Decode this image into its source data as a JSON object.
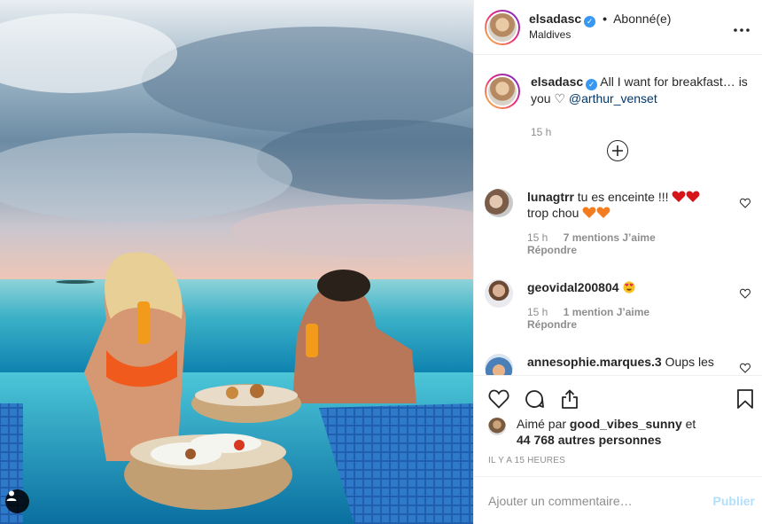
{
  "header": {
    "username": "elsadasc",
    "separator": "•",
    "follow_status": "Abonné(e)",
    "location": "Maldives",
    "more_icon": "more-horizontal-icon"
  },
  "caption": {
    "username": "elsadasc",
    "text": "All I want for breakfast… is you ♡",
    "mention": "@arthur_venset",
    "time": "15 h"
  },
  "comments": [
    {
      "username": "lunagtrr",
      "text": "tu es enceinte !!!",
      "text2": "trop chou",
      "time": "15 h",
      "likes": "7 mentions J’aime",
      "reply": "Répondre"
    },
    {
      "username": "geovidal200804",
      "text": "",
      "time": "15 h",
      "likes": "1 mention J’aime",
      "reply": "Répondre"
    },
    {
      "username": "annesophie.marques.3",
      "text": "Oups les",
      "time": "",
      "likes": "",
      "reply": ""
    }
  ],
  "likes": {
    "prefix": "Aimé par",
    "user": "good_vibes_sunny",
    "and": "et",
    "others": "44 768 autres personnes"
  },
  "timestamp": "IL Y A 15 HEURES",
  "add_comment": {
    "placeholder": "Ajouter un commentaire…",
    "post_label": "Publier"
  },
  "colors": {
    "verified": "#3897f0",
    "link": "#00376b",
    "muted": "#8e8e8e",
    "post_disabled": "#b2dffc"
  }
}
